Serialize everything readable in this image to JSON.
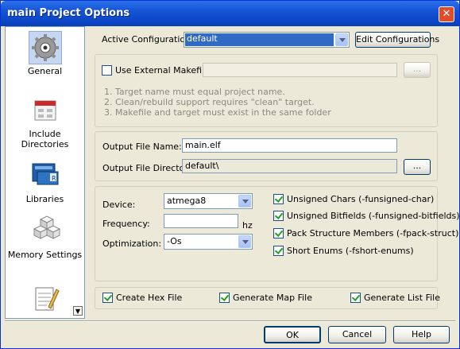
{
  "window": {
    "title": "main Project Options",
    "close_glyph": "✕"
  },
  "sidebar": {
    "items": [
      {
        "label": "General",
        "icon": "gear-icon"
      },
      {
        "label": "Include Directories",
        "icon": "folder-icon"
      },
      {
        "label": "Libraries",
        "icon": "books-icon"
      },
      {
        "label": "Memory Settings",
        "icon": "memory-blocks-icon"
      },
      {
        "label": "",
        "icon": "notepad-icon"
      }
    ],
    "scroll_glyph": "▼"
  },
  "config": {
    "label": "Active Configuration",
    "value": "default",
    "edit_button": "Edit Configurations"
  },
  "makefile": {
    "checkbox_label": "Use External Makefile",
    "checked": false,
    "path_value": "",
    "browse_label": "...",
    "notes": [
      "1. Target name must equal project name.",
      "2. Clean/rebuild support requires  \"clean\" target.",
      "3. Makefile and target must exist in the same folder"
    ]
  },
  "output": {
    "name_label": "Output File Name:",
    "name_value": "main.elf",
    "dir_label": "Output File Directory:",
    "dir_value": "default\\",
    "browse_label": "..."
  },
  "device": {
    "device_label": "Device:",
    "device_value": "atmega8",
    "frequency_label": "Frequency:",
    "frequency_value": "",
    "frequency_unit": "hz",
    "optimization_label": "Optimization:",
    "optimization_value": "-Os",
    "options": [
      {
        "label": "Unsigned Chars (-funsigned-char)",
        "checked": true
      },
      {
        "label": "Unsigned Bitfields (-funsigned-bitfields)",
        "checked": true
      },
      {
        "label": "Pack Structure Members (-fpack-struct)",
        "checked": true
      },
      {
        "label": "Short Enums (-fshort-enums)",
        "checked": true
      }
    ]
  },
  "files": [
    {
      "label": "Create Hex File",
      "checked": true
    },
    {
      "label": "Generate Map File",
      "checked": true
    },
    {
      "label": "Generate List File",
      "checked": true
    }
  ],
  "buttons": {
    "ok": "OK",
    "cancel": "Cancel",
    "help": "Help"
  }
}
